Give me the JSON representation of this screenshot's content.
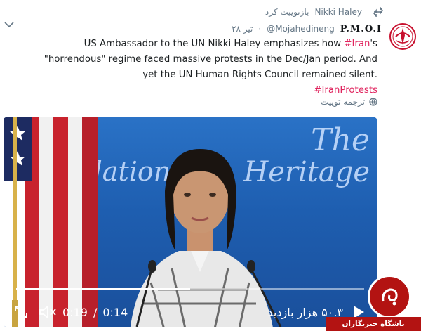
{
  "retweet": {
    "text": "بازتوییت کرد",
    "user": "Nikki Haley"
  },
  "tweet": {
    "display_name": "P.M.O.I",
    "handle": "@Mojahedineng",
    "date": "۲۸ تیر",
    "text_part1": "US Ambassador to the UN Nikki Haley emphasizes how ",
    "hashtag_iran": "#Iran",
    "text_part2": "'s \"horrendous\" regime faced massive protests in the Dec/Jan period. And yet the UN Human Rights Council remained silent.",
    "hashtag_protests": "#IranProtests",
    "translate_label": "ترجمه توییت"
  },
  "video": {
    "logo_the": "The",
    "logo_heritage": "Heritage",
    "logo_foundation": "ndation",
    "time_current": "0:19",
    "time_total": "0:14",
    "views": "۵۰.۳ هزار بازدید",
    "progress": 0.5
  },
  "watermark": {
    "label": "باشگاه خبرنگاران"
  },
  "colors": {
    "hashtag": "#e0245e",
    "meta": "#657786",
    "watermark_red": "#b31312"
  },
  "icons": [
    "retweet-icon",
    "chevron-down-icon",
    "globe-icon",
    "fullscreen-icon",
    "mute-icon",
    "play-icon"
  ]
}
